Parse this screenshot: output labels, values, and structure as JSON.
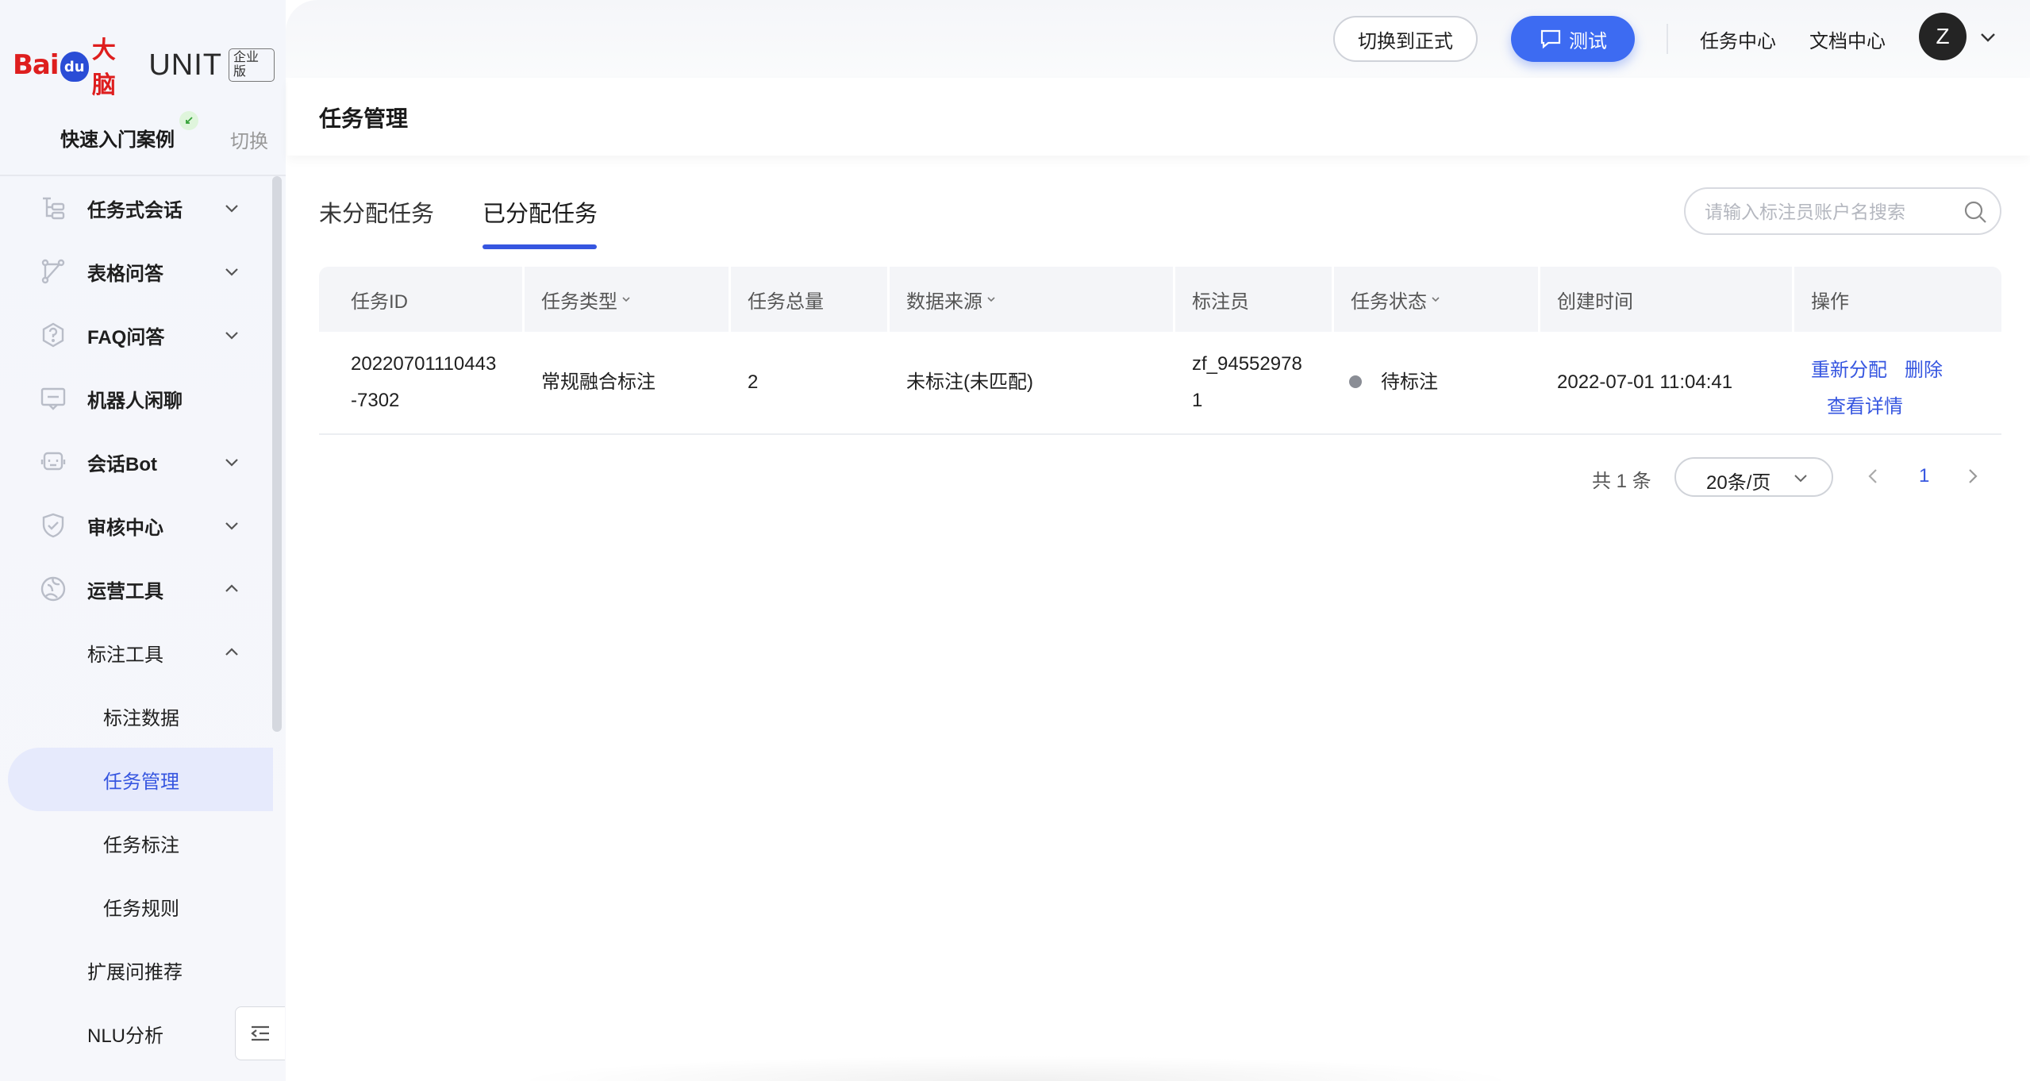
{
  "brand": {
    "bai": "Bai",
    "paw": "du",
    "dn": "大脑",
    "unit": "UNIT",
    "badge": "企业版"
  },
  "app": {
    "name": "快速入门案例",
    "switch_label": "切换"
  },
  "sidebar": {
    "items": [
      {
        "label": "任务式会话",
        "icon": "task-dialog-icon"
      },
      {
        "label": "表格问答",
        "icon": "table-qa-icon"
      },
      {
        "label": "FAQ问答",
        "icon": "faq-icon"
      },
      {
        "label": "机器人闲聊",
        "icon": "chat-icon"
      },
      {
        "label": "会话Bot",
        "icon": "bot-icon"
      },
      {
        "label": "审核中心",
        "icon": "shield-icon"
      },
      {
        "label": "运营工具",
        "icon": "operations-icon"
      }
    ],
    "sub": {
      "label": "标注工具"
    },
    "leaves": [
      {
        "label": "标注数据"
      },
      {
        "label": "任务管理"
      },
      {
        "label": "任务标注"
      },
      {
        "label": "任务规则"
      }
    ],
    "extra": [
      {
        "label": "扩展问推荐"
      },
      {
        "label": "NLU分析"
      }
    ]
  },
  "topbar": {
    "switch_formal": "切换到正式",
    "test": "测试",
    "task_center": "任务中心",
    "doc_center": "文档中心",
    "avatar_letter": "Z"
  },
  "page": {
    "title": "任务管理"
  },
  "tabs": [
    {
      "label": "未分配任务",
      "active": false
    },
    {
      "label": "已分配任务",
      "active": true
    }
  ],
  "search": {
    "placeholder": "请输入标注员账户名搜索"
  },
  "table": {
    "columns": [
      "任务ID",
      "任务类型",
      "任务总量",
      "数据来源",
      "标注员",
      "任务状态",
      "创建时间",
      "操作"
    ],
    "rows": [
      {
        "id_line1": "20220701110443",
        "id_line2": "-7302",
        "type": "常规融合标注",
        "total": "2",
        "source": "未标注(未匹配)",
        "annotator_line1": "zf_94552978",
        "annotator_line2": "1",
        "status": "待标注",
        "created": "2022-07-01 11:04:41",
        "ops": [
          "重新分配",
          "删除",
          "查看详情"
        ]
      }
    ]
  },
  "pagination": {
    "total": "共 1 条",
    "page_size": "20条/页",
    "current": "1"
  },
  "colors": {
    "accent": "#3656e0",
    "test_button": "#3d6bf2",
    "brand_red": "#de1e1e"
  }
}
